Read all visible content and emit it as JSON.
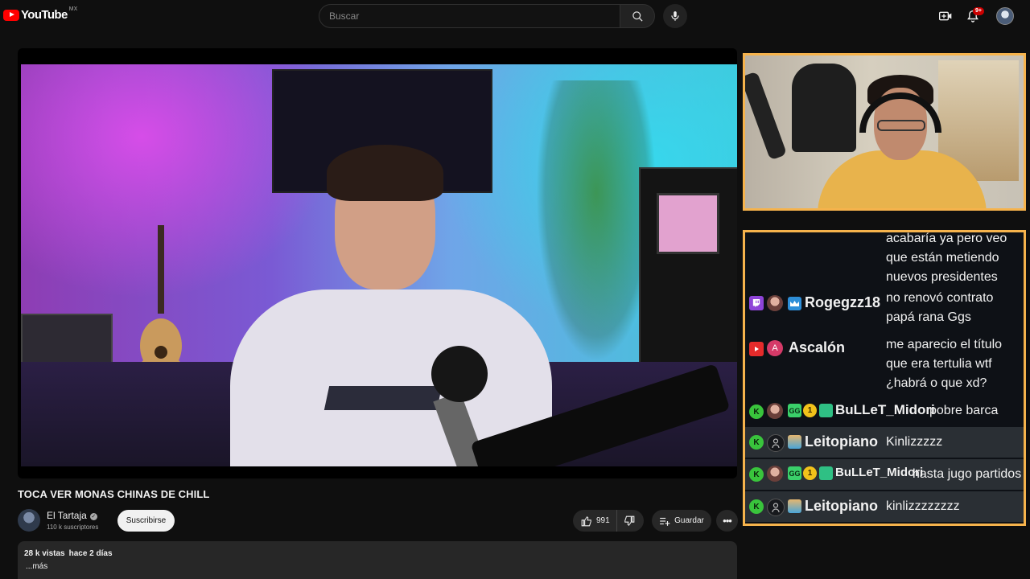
{
  "header": {
    "logo_text": "YouTube",
    "region": "MX",
    "search_placeholder": "Buscar",
    "notifications_badge": "9+"
  },
  "video": {
    "title": "TOCA VER MONAS CHINAS DE CHILL",
    "channel_name": "El Tartaja",
    "subscribers": "110 k suscriptores",
    "subscribe_label": "Suscribirse",
    "likes": "991",
    "save_label": "Guardar",
    "more_label": "•••",
    "views": "28 k vistas",
    "published": "hace 2 días",
    "desc_more": "...más"
  },
  "chat": {
    "continued_message": [
      "acabaría ya pero veo",
      "que están metiendo",
      "nuevos presidentes"
    ],
    "messages": [
      {
        "platform": "twitch",
        "user": "Rogegzz18",
        "lines": [
          "no renovó contrato",
          "papá rana Ggs"
        ]
      },
      {
        "platform": "youtube",
        "avatar_letter": "A",
        "user": "Ascalón",
        "lines": [
          "me aparecio el título",
          "que era tertulia wtf",
          "¿habrá o que xd?"
        ]
      },
      {
        "platform": "kick",
        "badge_one": "1",
        "user": "BuLLeT_Midori",
        "lines": [
          "pobre barca"
        ]
      },
      {
        "platform": "kick",
        "user": "Leitopiano",
        "lines": [
          "Kinlizzzzz"
        ]
      },
      {
        "platform": "kick",
        "badge_one": "1",
        "user": "BuLLeT_Midori",
        "lines": [
          "hasta jugo partidos"
        ]
      },
      {
        "platform": "kick",
        "user": "Leitopiano",
        "lines": [
          "kinlizzzzzzzz"
        ]
      }
    ],
    "badge_gg": "GG",
    "kick_icon": "K"
  },
  "colors": {
    "accent_red": "#ff0000",
    "overlay_border": "#f6b34c",
    "twitch": "#8e44d8",
    "kick": "#39c43c"
  }
}
